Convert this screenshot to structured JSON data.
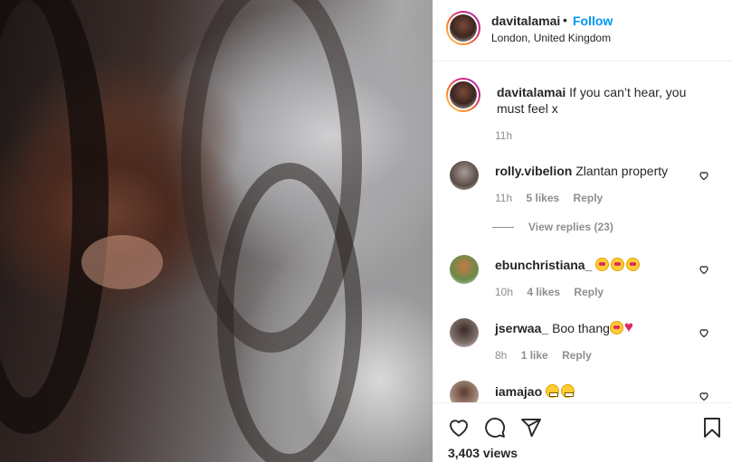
{
  "post": {
    "username": "davitalamai",
    "separator": "•",
    "follow_label": "Follow",
    "location": "London, United Kingdom"
  },
  "caption": {
    "username": "davitalamai",
    "text": "If you can’t hear, you must feel x",
    "time": "11h"
  },
  "comments": [
    {
      "username": "rolly.vibelion",
      "text": "Zlantan property",
      "emojis": [],
      "time": "11h",
      "likes": "5 likes",
      "reply_label": "Reply",
      "view_replies": "View replies (23)"
    },
    {
      "username": "ebunchristiana_",
      "text": "",
      "emojis": [
        "heart-eyes",
        "heart-eyes",
        "heart-eyes"
      ],
      "time": "10h",
      "likes": "4 likes",
      "reply_label": "Reply"
    },
    {
      "username": "jserwaa_",
      "text": "Boo thang",
      "emojis": [
        "heart-eyes",
        "red-heart"
      ],
      "time": "8h",
      "likes": "1 like",
      "reply_label": "Reply"
    },
    {
      "username": "iamajao",
      "text": "",
      "emojis": [
        "grimace",
        "grimace"
      ]
    }
  ],
  "footer": {
    "views": "3,403 views",
    "icons": [
      "heart-icon",
      "comment-icon",
      "share-icon",
      "bookmark-icon"
    ]
  },
  "colors": {
    "accent": "#0095f6",
    "text": "#262626",
    "muted": "#8e8e8e",
    "border": "#efefef"
  }
}
